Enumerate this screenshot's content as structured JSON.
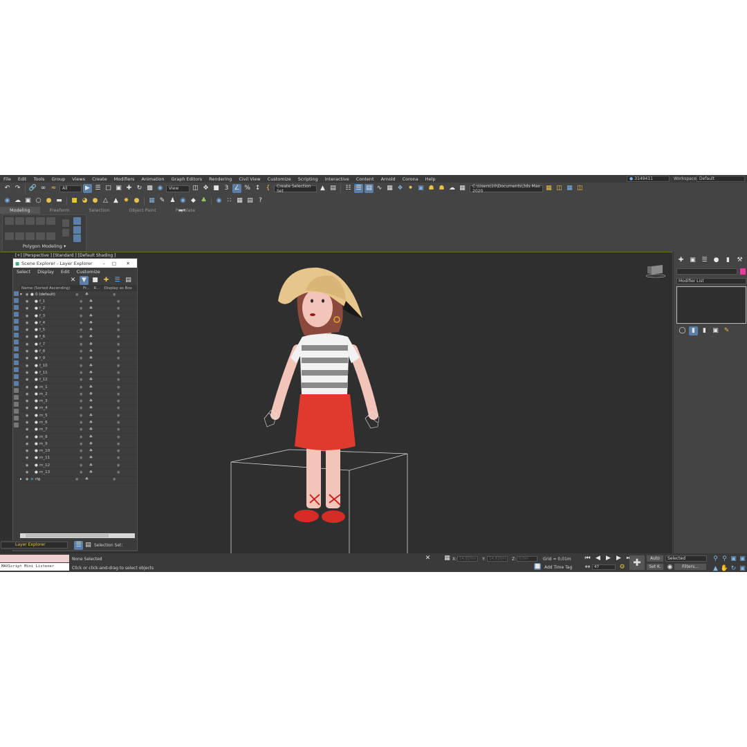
{
  "menu": [
    "File",
    "Edit",
    "Tools",
    "Group",
    "Views",
    "Create",
    "Modifiers",
    "Animation",
    "Graph Editors",
    "Rendering",
    "Civil View",
    "Customize",
    "Scripting",
    "Interactive",
    "Content",
    "Arnold",
    "Corona",
    "Help"
  ],
  "user": "3149411",
  "workspaces_label": "Workspaces:",
  "workspace_value": "Default",
  "toolbar": {
    "filter_value": "All",
    "view_value": "View",
    "selection_set": "Create Selection Set",
    "path": "C:\\Users\\10\\Documents\\3ds Max 2020"
  },
  "ribbon": {
    "tabs": [
      "Modeling",
      "Freeform",
      "Selection",
      "Object Paint",
      "Populate"
    ],
    "panel_label": "Polygon Modeling"
  },
  "viewport_label": "[+] [Perspective ] [Standard ] [Default Shading ]",
  "scene_explorer": {
    "title": "Scene Explorer - Layer Explorer",
    "menu": [
      "Select",
      "Display",
      "Edit",
      "Customize"
    ],
    "columns": [
      "Name (Sorted Ascending)",
      "Fr...",
      "R...",
      "Display as Box"
    ],
    "root_layer": "0 (default)",
    "items": [
      "f_1",
      "f_2",
      "f_3",
      "f_4",
      "f_5",
      "f_6",
      "f_7",
      "f_8",
      "f_9",
      "f_10",
      "f_11",
      "f_12",
      "m_1",
      "m_2",
      "m_3",
      "m_4",
      "m_5",
      "m_6",
      "m_7",
      "m_8",
      "m_9",
      "m_10",
      "m_11",
      "m_12",
      "m_13"
    ],
    "rig_layer": "rig",
    "footer_label": "Layer Explorer",
    "selection_set_label": "Selection Set:"
  },
  "command_panel": {
    "modifier_list": "Modifier List"
  },
  "status": {
    "listener": "MAXScript Mini Listener",
    "none_selected": "None Selected",
    "prompt": "Click or click-and-drag to select objects",
    "x_label": "X:",
    "x_value": "14,820m",
    "y_label": "Y:",
    "y_value": "14,820m",
    "z_label": "Z:",
    "z_value": "0,0m",
    "grid": "Grid = 0,01m",
    "add_time_tag": "Add Time Tag",
    "frame": "47",
    "auto": "Auto",
    "selected": "Selected",
    "set_key": "Set K.",
    "filters": "Filters..."
  },
  "colors": {
    "accent": "#5b7fa6",
    "skirt": "#e03a2e",
    "hat": "#e6c68a",
    "stripe_dark": "#8a8a8a"
  }
}
